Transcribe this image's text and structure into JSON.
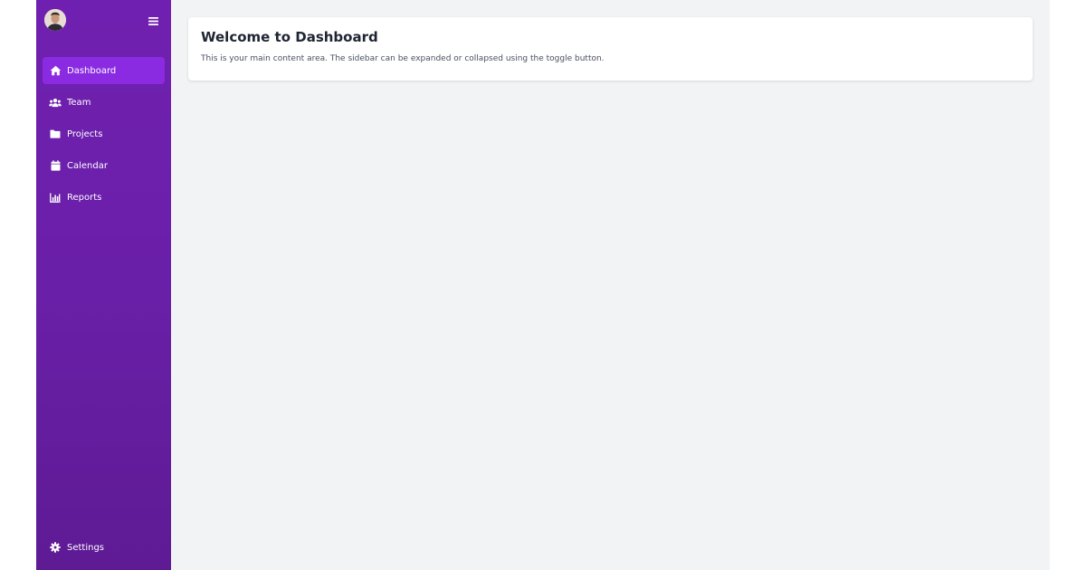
{
  "sidebar": {
    "avatar_icon": "user-avatar",
    "toggle_icon": "hamburger-icon",
    "items": [
      {
        "label": "Dashboard",
        "icon": "home-icon",
        "active": true
      },
      {
        "label": "Team",
        "icon": "users-icon",
        "active": false
      },
      {
        "label": "Projects",
        "icon": "folder-icon",
        "active": false
      },
      {
        "label": "Calendar",
        "icon": "calendar-icon",
        "active": false
      },
      {
        "label": "Reports",
        "icon": "chart-icon",
        "active": false
      }
    ],
    "settings": {
      "label": "Settings",
      "icon": "gear-icon"
    }
  },
  "main": {
    "title": "Welcome to Dashboard",
    "description": "This is your main content area. The sidebar can be expanded or collapsed using the toggle button."
  },
  "colors": {
    "sidebar_top": "#7020b0",
    "sidebar_bottom": "#5e1b94",
    "active_item": "#8a2be2",
    "background": "#f2f3f5"
  }
}
